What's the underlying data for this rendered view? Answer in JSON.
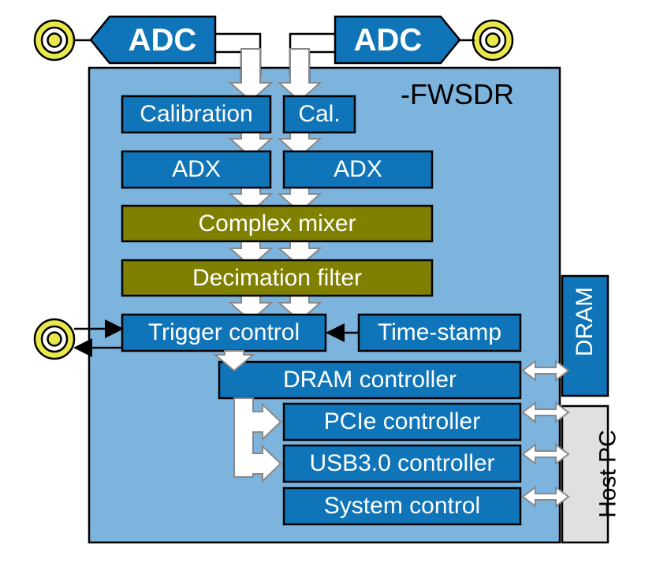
{
  "diagram": {
    "title_label": "-FWSDR",
    "colors": {
      "board_fill": "#7cb4dd",
      "block_blue": "#0f74b8",
      "block_olive": "#808000",
      "host_gray": "#e0e0e0",
      "connector_yellow": "#e8e84a",
      "arrow_white": "#ffffff",
      "outline_black": "#000000",
      "text_white": "#ffffff",
      "text_black": "#000000"
    },
    "adc_blocks": [
      {
        "id": "adc-left",
        "label": "ADC",
        "direction": "left"
      },
      {
        "id": "adc-right",
        "label": "ADC",
        "direction": "right"
      }
    ],
    "connectors": [
      {
        "id": "rf-input-left",
        "name": "coax-connector"
      },
      {
        "id": "rf-input-right",
        "name": "coax-connector"
      },
      {
        "id": "trigger-io",
        "name": "coax-connector"
      }
    ],
    "blocks": [
      {
        "id": "calibration",
        "label": "Calibration",
        "color": "blue"
      },
      {
        "id": "cal",
        "label": "Cal.",
        "color": "blue"
      },
      {
        "id": "adx-left",
        "label": "ADX",
        "color": "blue"
      },
      {
        "id": "adx-right",
        "label": "ADX",
        "color": "blue"
      },
      {
        "id": "complex-mixer",
        "label": "Complex mixer",
        "color": "olive"
      },
      {
        "id": "decimation-filter",
        "label": "Decimation filter",
        "color": "olive"
      },
      {
        "id": "trigger-control",
        "label": "Trigger control",
        "color": "blue"
      },
      {
        "id": "time-stamp",
        "label": "Time-stamp",
        "color": "blue"
      },
      {
        "id": "dram-controller",
        "label": "DRAM controller",
        "color": "blue"
      },
      {
        "id": "pcie-controller",
        "label": "PCIe controller",
        "color": "blue"
      },
      {
        "id": "usb-controller",
        "label": "USB3.0 controller",
        "color": "blue"
      },
      {
        "id": "system-control",
        "label": "System control",
        "color": "blue"
      }
    ],
    "external": [
      {
        "id": "dram",
        "label": "DRAM",
        "color": "blue",
        "orientation": "vertical"
      },
      {
        "id": "host-pc",
        "label": "Host PC",
        "color": "gray",
        "orientation": "vertical"
      }
    ]
  }
}
